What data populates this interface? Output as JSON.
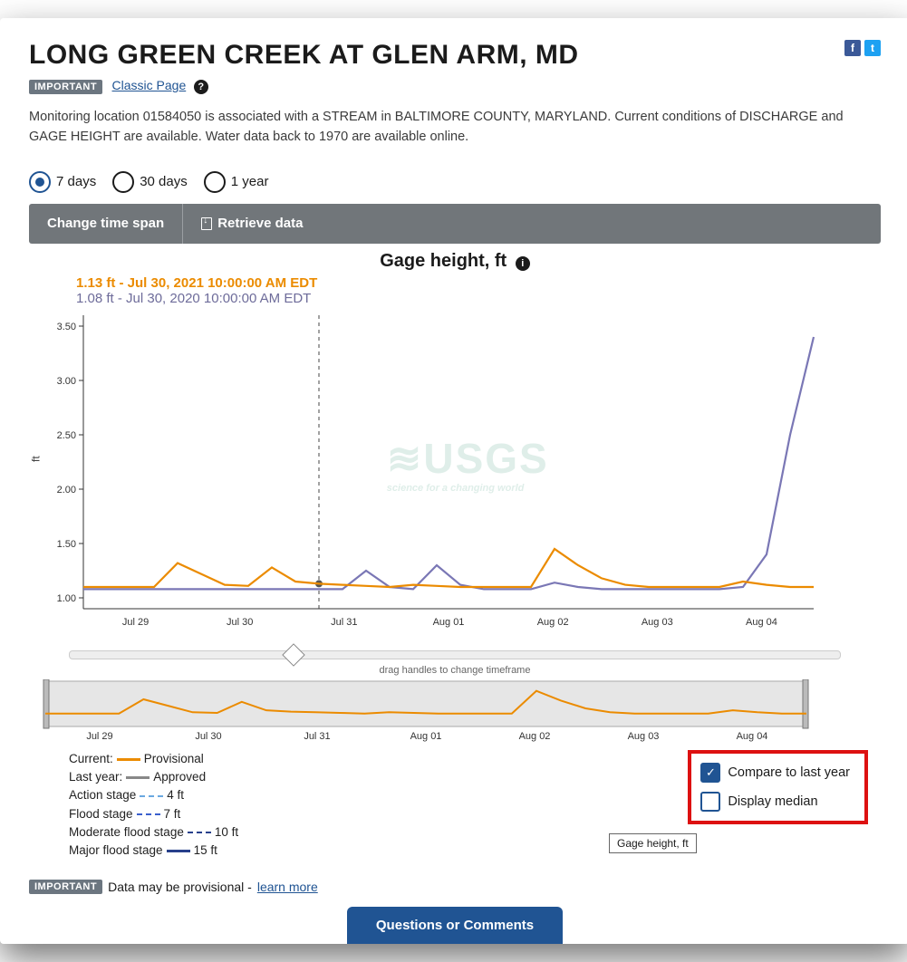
{
  "header": {
    "title": "LONG GREEN CREEK AT GLEN ARM, MD",
    "badge": "IMPORTANT",
    "classic_link": "Classic Page",
    "description": "Monitoring location 01584050 is associated with a STREAM in BALTIMORE COUNTY, MARYLAND. Current conditions of DISCHARGE and GAGE HEIGHT are available. Water data back to 1970 are available online."
  },
  "timespan": {
    "options": [
      "7 days",
      "30 days",
      "1 year"
    ],
    "selected": 0
  },
  "toolbar": {
    "change_label": "Change time span",
    "retrieve_label": "Retrieve data"
  },
  "chart": {
    "title": "Gage height, ft",
    "readout_current": "1.13 ft - Jul 30, 2021 10:00:00 AM EDT",
    "readout_lastyear": "1.08 ft - Jul 30, 2020 10:00:00 AM EDT",
    "y_unit": "ft",
    "tooltip": "Gage height, ft",
    "watermark": "USGS",
    "watermark_sub": "science for a changing world"
  },
  "chart_data": {
    "type": "line",
    "xlabel": "",
    "ylabel": "ft",
    "ylim": [
      0.9,
      3.6
    ],
    "y_ticks": [
      1.0,
      1.5,
      2.0,
      2.5,
      3.0,
      3.5
    ],
    "categories": [
      "Jul 29",
      "Jul 30",
      "Jul 31",
      "Aug 01",
      "Aug 02",
      "Aug 03",
      "Aug 04"
    ],
    "series": [
      {
        "name": "Current (2021, Provisional)",
        "color": "#eb8b00",
        "values": [
          1.1,
          1.1,
          1.1,
          1.1,
          1.32,
          1.22,
          1.12,
          1.11,
          1.28,
          1.15,
          1.13,
          1.12,
          1.11,
          1.1,
          1.12,
          1.11,
          1.1,
          1.1,
          1.1,
          1.1,
          1.45,
          1.3,
          1.18,
          1.12,
          1.1,
          1.1,
          1.1,
          1.1,
          1.15,
          1.12,
          1.1,
          1.1
        ]
      },
      {
        "name": "Last year (2020, Approved)",
        "color": "#7a77b5",
        "values": [
          1.08,
          1.08,
          1.08,
          1.08,
          1.08,
          1.08,
          1.08,
          1.08,
          1.08,
          1.08,
          1.08,
          1.08,
          1.25,
          1.1,
          1.08,
          1.3,
          1.12,
          1.08,
          1.08,
          1.08,
          1.14,
          1.1,
          1.08,
          1.08,
          1.08,
          1.08,
          1.08,
          1.08,
          1.1,
          1.4,
          2.5,
          3.4
        ]
      }
    ],
    "cursor_index": 10,
    "slider_position_pct": 28
  },
  "mini": {
    "drag_hint": "drag handles to change timeframe"
  },
  "legend": {
    "current": "Current:",
    "current_val": "Provisional",
    "lastyear": "Last year:",
    "lastyear_val": "Approved",
    "action": "Action stage",
    "action_val": "4 ft",
    "flood": "Flood stage",
    "flood_val": "7 ft",
    "mod": "Moderate flood stage",
    "mod_val": "10 ft",
    "maj": "Major flood stage",
    "maj_val": "15 ft"
  },
  "controls": {
    "compare": "Compare to last year",
    "compare_checked": true,
    "median": "Display median",
    "median_checked": false
  },
  "footer": {
    "badge": "IMPORTANT",
    "text": "Data may be provisional - ",
    "link": "learn more",
    "button": "Questions or Comments"
  }
}
